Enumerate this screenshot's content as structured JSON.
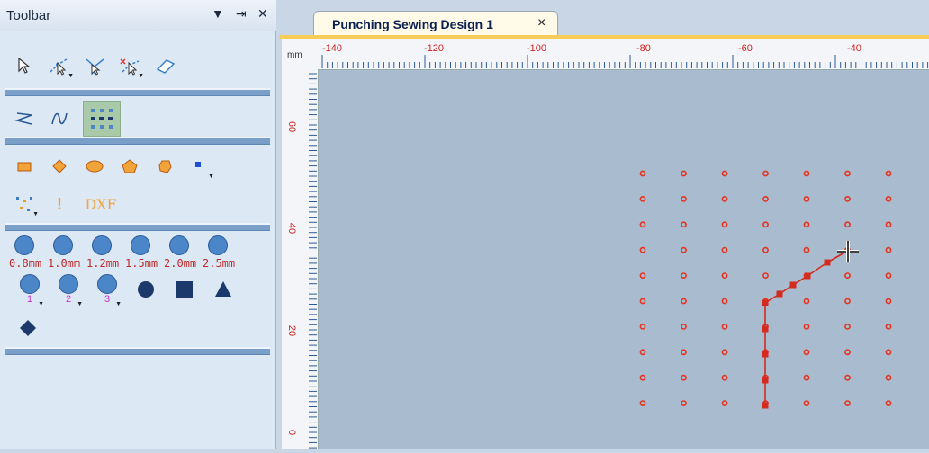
{
  "toolbar": {
    "title": "Toolbar",
    "buttons": {
      "dropdown": "▼",
      "pin": "⇥",
      "close": "✕"
    },
    "circle_sizes": [
      "0.8mm",
      "1.0mm",
      "1.2mm",
      "1.5mm",
      "2.0mm",
      "2.5mm"
    ],
    "numbered": [
      "1",
      "2",
      "3"
    ],
    "dxf_label": "DXF",
    "colors": {
      "shape_fill": "#f2a33a",
      "shape_stroke": "#b55b12",
      "circle": "#4a86c8",
      "shape_dark": "#1b3a6b"
    }
  },
  "document": {
    "tab_label": "Punching Sewing Design 1",
    "close_glyph": "×"
  },
  "ruler": {
    "unit": "mm",
    "horizontal_labels": [
      "-140",
      "-120",
      "-100",
      "-80",
      "-60",
      "-40"
    ],
    "vertical_labels": [
      "60",
      "40",
      "20",
      "0"
    ]
  },
  "canvas": {
    "grid_point_color": "#e8311c",
    "path_color": "#d52a1e",
    "grid_columns": 7,
    "grid_rows": 10
  }
}
